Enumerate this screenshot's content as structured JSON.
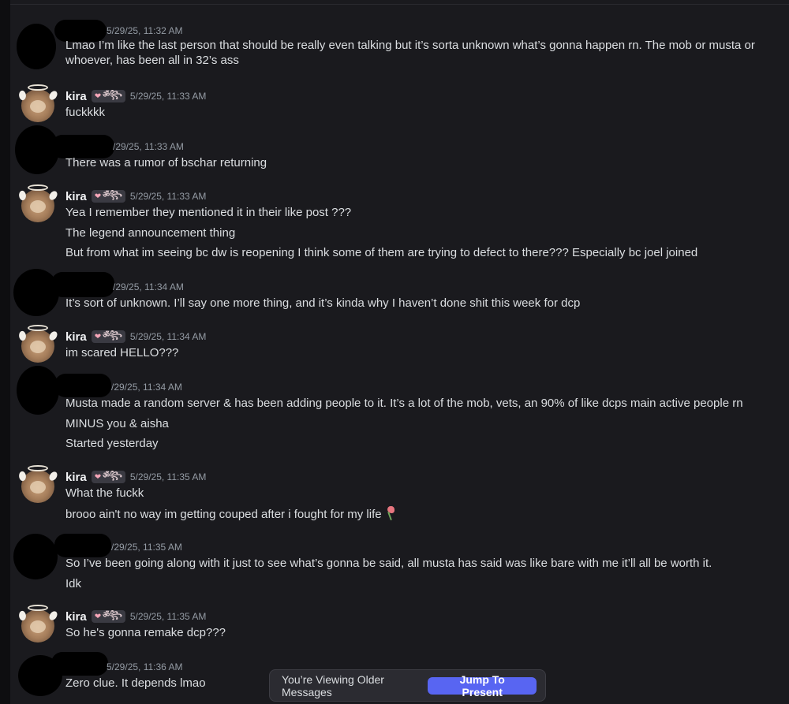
{
  "messages": [
    {
      "author": "",
      "redacted": true,
      "timestamp": "5/29/25, 11:32 AM",
      "lines": [
        "Lmao I’m like the last person that should be really even talking but it’s sorta unknown what’s gonna happen rn. The mob or musta or whoever, has been all in 32’s ass"
      ]
    },
    {
      "author": "kira",
      "badge": "ॐ꧂",
      "timestamp": "5/29/25, 11:33 AM",
      "lines": [
        "fuckkkk"
      ]
    },
    {
      "author": "",
      "redacted": true,
      "timestamp": "/29/25, 11:33 AM",
      "lines": [
        "There was a rumor of bschar returning"
      ]
    },
    {
      "author": "kira",
      "badge": "ॐ꧂",
      "timestamp": "5/29/25, 11:33 AM",
      "lines": [
        "Yea I remember they mentioned it in their like post ???",
        "The legend announcement thing",
        "But from what im seeing bc dw is reopening I think some of them are trying to defect to there??? Especially bc joel joined"
      ]
    },
    {
      "author": "",
      "redacted": true,
      "timestamp": "/29/25, 11:34 AM",
      "lines": [
        "It’s sort of unknown. I’ll say one more thing, and it’s kinda why I haven’t done shit this week for dcp"
      ]
    },
    {
      "author": "kira",
      "badge": "ॐ꧂",
      "timestamp": "5/29/25, 11:34 AM",
      "lines": [
        "im scared HELLO???"
      ]
    },
    {
      "author": "",
      "redacted": true,
      "timestamp": "/29/25, 11:34 AM",
      "lines": [
        "Musta made a random server & has been adding people to it. It’s a lot of the mob, vets, an 90% of like dcps main active people rn",
        "MINUS you & aisha",
        "Started yesterday"
      ]
    },
    {
      "author": "kira",
      "badge": "ॐ꧂",
      "timestamp": "5/29/25, 11:35 AM",
      "lines": [
        "What the fuckk",
        "brooo ain't no way im getting couped after i fought for my life"
      ]
    },
    {
      "author": "",
      "redacted": true,
      "timestamp": "/29/25, 11:35 AM",
      "lines": [
        "So I’ve been going along with it just to see what’s gonna be said, all musta has said was like bare with me it’ll all be worth it.",
        "Idk"
      ]
    },
    {
      "author": "kira",
      "badge": "ॐ꧂",
      "timestamp": "5/29/25, 11:35 AM",
      "lines": [
        "So he's gonna remake dcp???"
      ]
    },
    {
      "author": "",
      "redacted": true,
      "timestamp": "5/29/25, 11:36 AM",
      "lines": [
        "Zero clue. It depends lmao"
      ]
    }
  ],
  "banner": {
    "text": "You’re Viewing Older Messages",
    "button": "Jump To Present"
  },
  "colors": {
    "accent": "#5865f2",
    "background": "#1a1a1e",
    "timestamp": "#949ba4"
  }
}
